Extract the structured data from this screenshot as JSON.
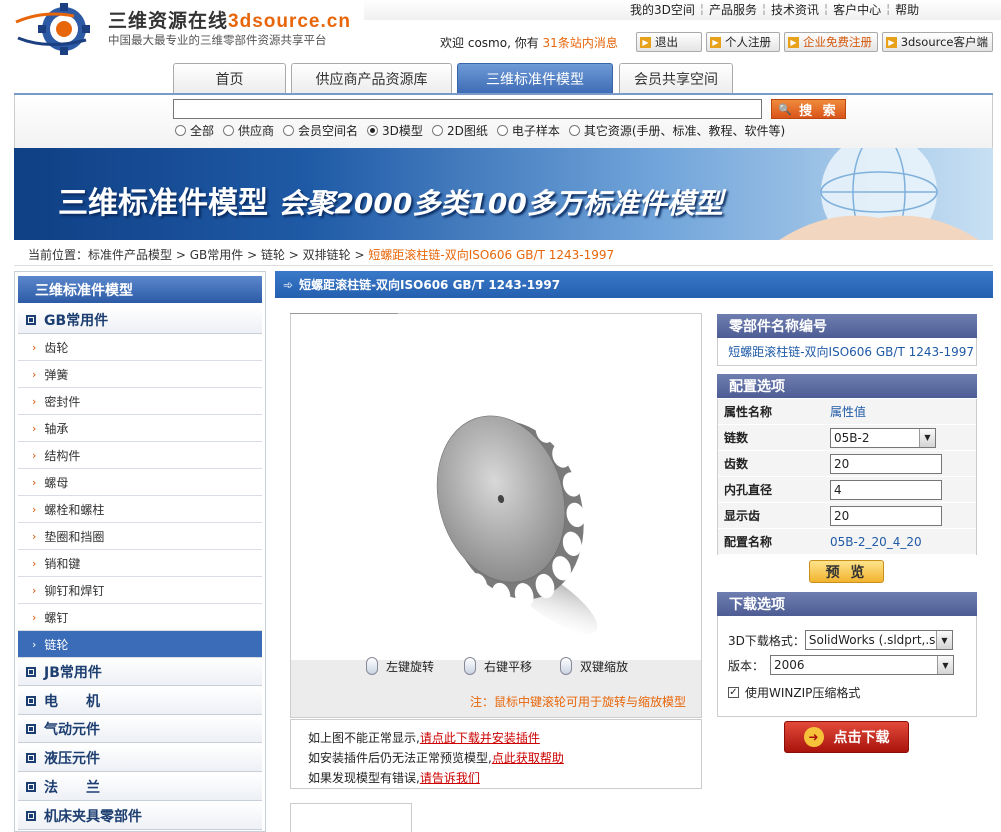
{
  "header": {
    "site_name_cn": "三维资源在线",
    "site_name_brand": "3dsource.cn",
    "tagline": "中国最大最专业的三维零部件资源共享平台",
    "top_links": [
      "我的3D空间",
      "产品服务",
      "技术资讯",
      "客户中心",
      "帮助"
    ],
    "welcome_prefix": "欢迎",
    "username": "cosmo",
    "welcome_suffix": ", 你有",
    "messages": "31条站内消息",
    "buttons": {
      "logout": "退出",
      "personal_register": "个人注册",
      "enterprise_register": "企业免费注册",
      "client": "3dsource客户端"
    }
  },
  "tabs": [
    "首页",
    "供应商产品资源库",
    "三维标准件模型",
    "会员共享空间"
  ],
  "active_tab": 2,
  "search": {
    "value": "",
    "button": "搜 索",
    "options": [
      "全部",
      "供应商",
      "会员空间名",
      "3D模型",
      "2D图纸",
      "电子样本",
      "其它资源(手册、标准、教程、软件等)"
    ],
    "selected": 3
  },
  "banner": {
    "title": "三维标准件模型",
    "subtitle": "会聚2000多类100多万标准件模型"
  },
  "breadcrumb": {
    "label": "当前位置：",
    "path": [
      "标准件产品模型",
      "GB常用件",
      "链轮",
      "双排链轮"
    ],
    "current": "短螺距滚柱链-双向ISO606 GB/T 1243-1997"
  },
  "sidebar": {
    "title": "三维标准件模型",
    "category_gb": "GB常用件",
    "items": [
      "齿轮",
      "弹簧",
      "密封件",
      "轴承",
      "结构件",
      "螺母",
      "螺栓和螺柱",
      "垫圈和挡圈",
      "销和键",
      "铆钉和焊钉",
      "螺钉",
      "链轮"
    ],
    "active_item": 11,
    "categories": [
      "JB常用件",
      "电　　机",
      "气动元件",
      "液压元件",
      "法　　兰",
      "机床夹具零部件"
    ]
  },
  "main": {
    "title": "短螺距滚柱链-双向ISO606 GB/T 1243-1997",
    "viewer_controls": [
      "左键旋转",
      "右键平移",
      "双键缩放"
    ],
    "viewer_note": "注：鼠标中键滚轮可用于旋转与缩放模型",
    "notes": [
      {
        "text": "如上图不能正常显示,",
        "link": "请点此下载并安装插件"
      },
      {
        "text": "如安装插件后仍无法正常预览模型,",
        "link": "点此获取帮助"
      },
      {
        "text": "如果发现模型有错误,",
        "link": "请告诉我们"
      }
    ]
  },
  "part_name": {
    "heading": "零部件名称编号",
    "value": "短螺距滚柱链-双向ISO606 GB/T 1243-1997"
  },
  "config": {
    "heading": "配置选项",
    "col_name": "属性名称",
    "col_value": "属性值",
    "rows": [
      {
        "label": "链数",
        "value": "05B-2",
        "kind": "select"
      },
      {
        "label": "齿数",
        "value": "20",
        "kind": "input"
      },
      {
        "label": "内孔直径",
        "value": "4",
        "kind": "input"
      },
      {
        "label": "显示齿",
        "value": "20",
        "kind": "input"
      }
    ],
    "config_name_label": "配置名称",
    "config_name_value": "05B-2_20_4_20",
    "preview_button": "预 览"
  },
  "download": {
    "heading": "下载选项",
    "format_label": "3D下载格式：",
    "format_value": "SolidWorks (.sldprt,.s",
    "version_label": "版本：",
    "version_value": "2006",
    "winzip_label": "使用WINZIP压缩格式",
    "winzip_checked": true,
    "button": "点击下载"
  },
  "colors": {
    "accent_orange": "#e8660a",
    "nav_blue": "#3a6cb8",
    "panel_header": "#5b6a9e"
  }
}
